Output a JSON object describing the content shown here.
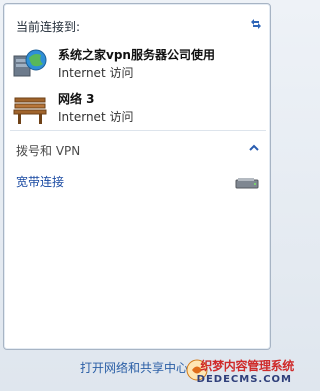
{
  "header": {
    "title": "当前连接到:"
  },
  "connections": [
    {
      "name": "系统之家vpn服务器公司使用",
      "status": "Internet 访问",
      "icon": "network-globe-icon"
    },
    {
      "name": "网络  3",
      "status": "Internet 访问",
      "icon": "park-bench-icon"
    }
  ],
  "dialup": {
    "title": "拨号和 VPN",
    "items": [
      {
        "label": "宽带连接",
        "icon": "modem-icon"
      }
    ]
  },
  "footer": {
    "link": "打开网络和共享中心"
  },
  "watermark": {
    "line1": "织梦内容管理系统",
    "line2": "DEDECMS.COM"
  },
  "colors": {
    "link": "#1a4aa2",
    "footer_link": "#2b5fa6",
    "watermark_red": "#cf2a2a"
  }
}
